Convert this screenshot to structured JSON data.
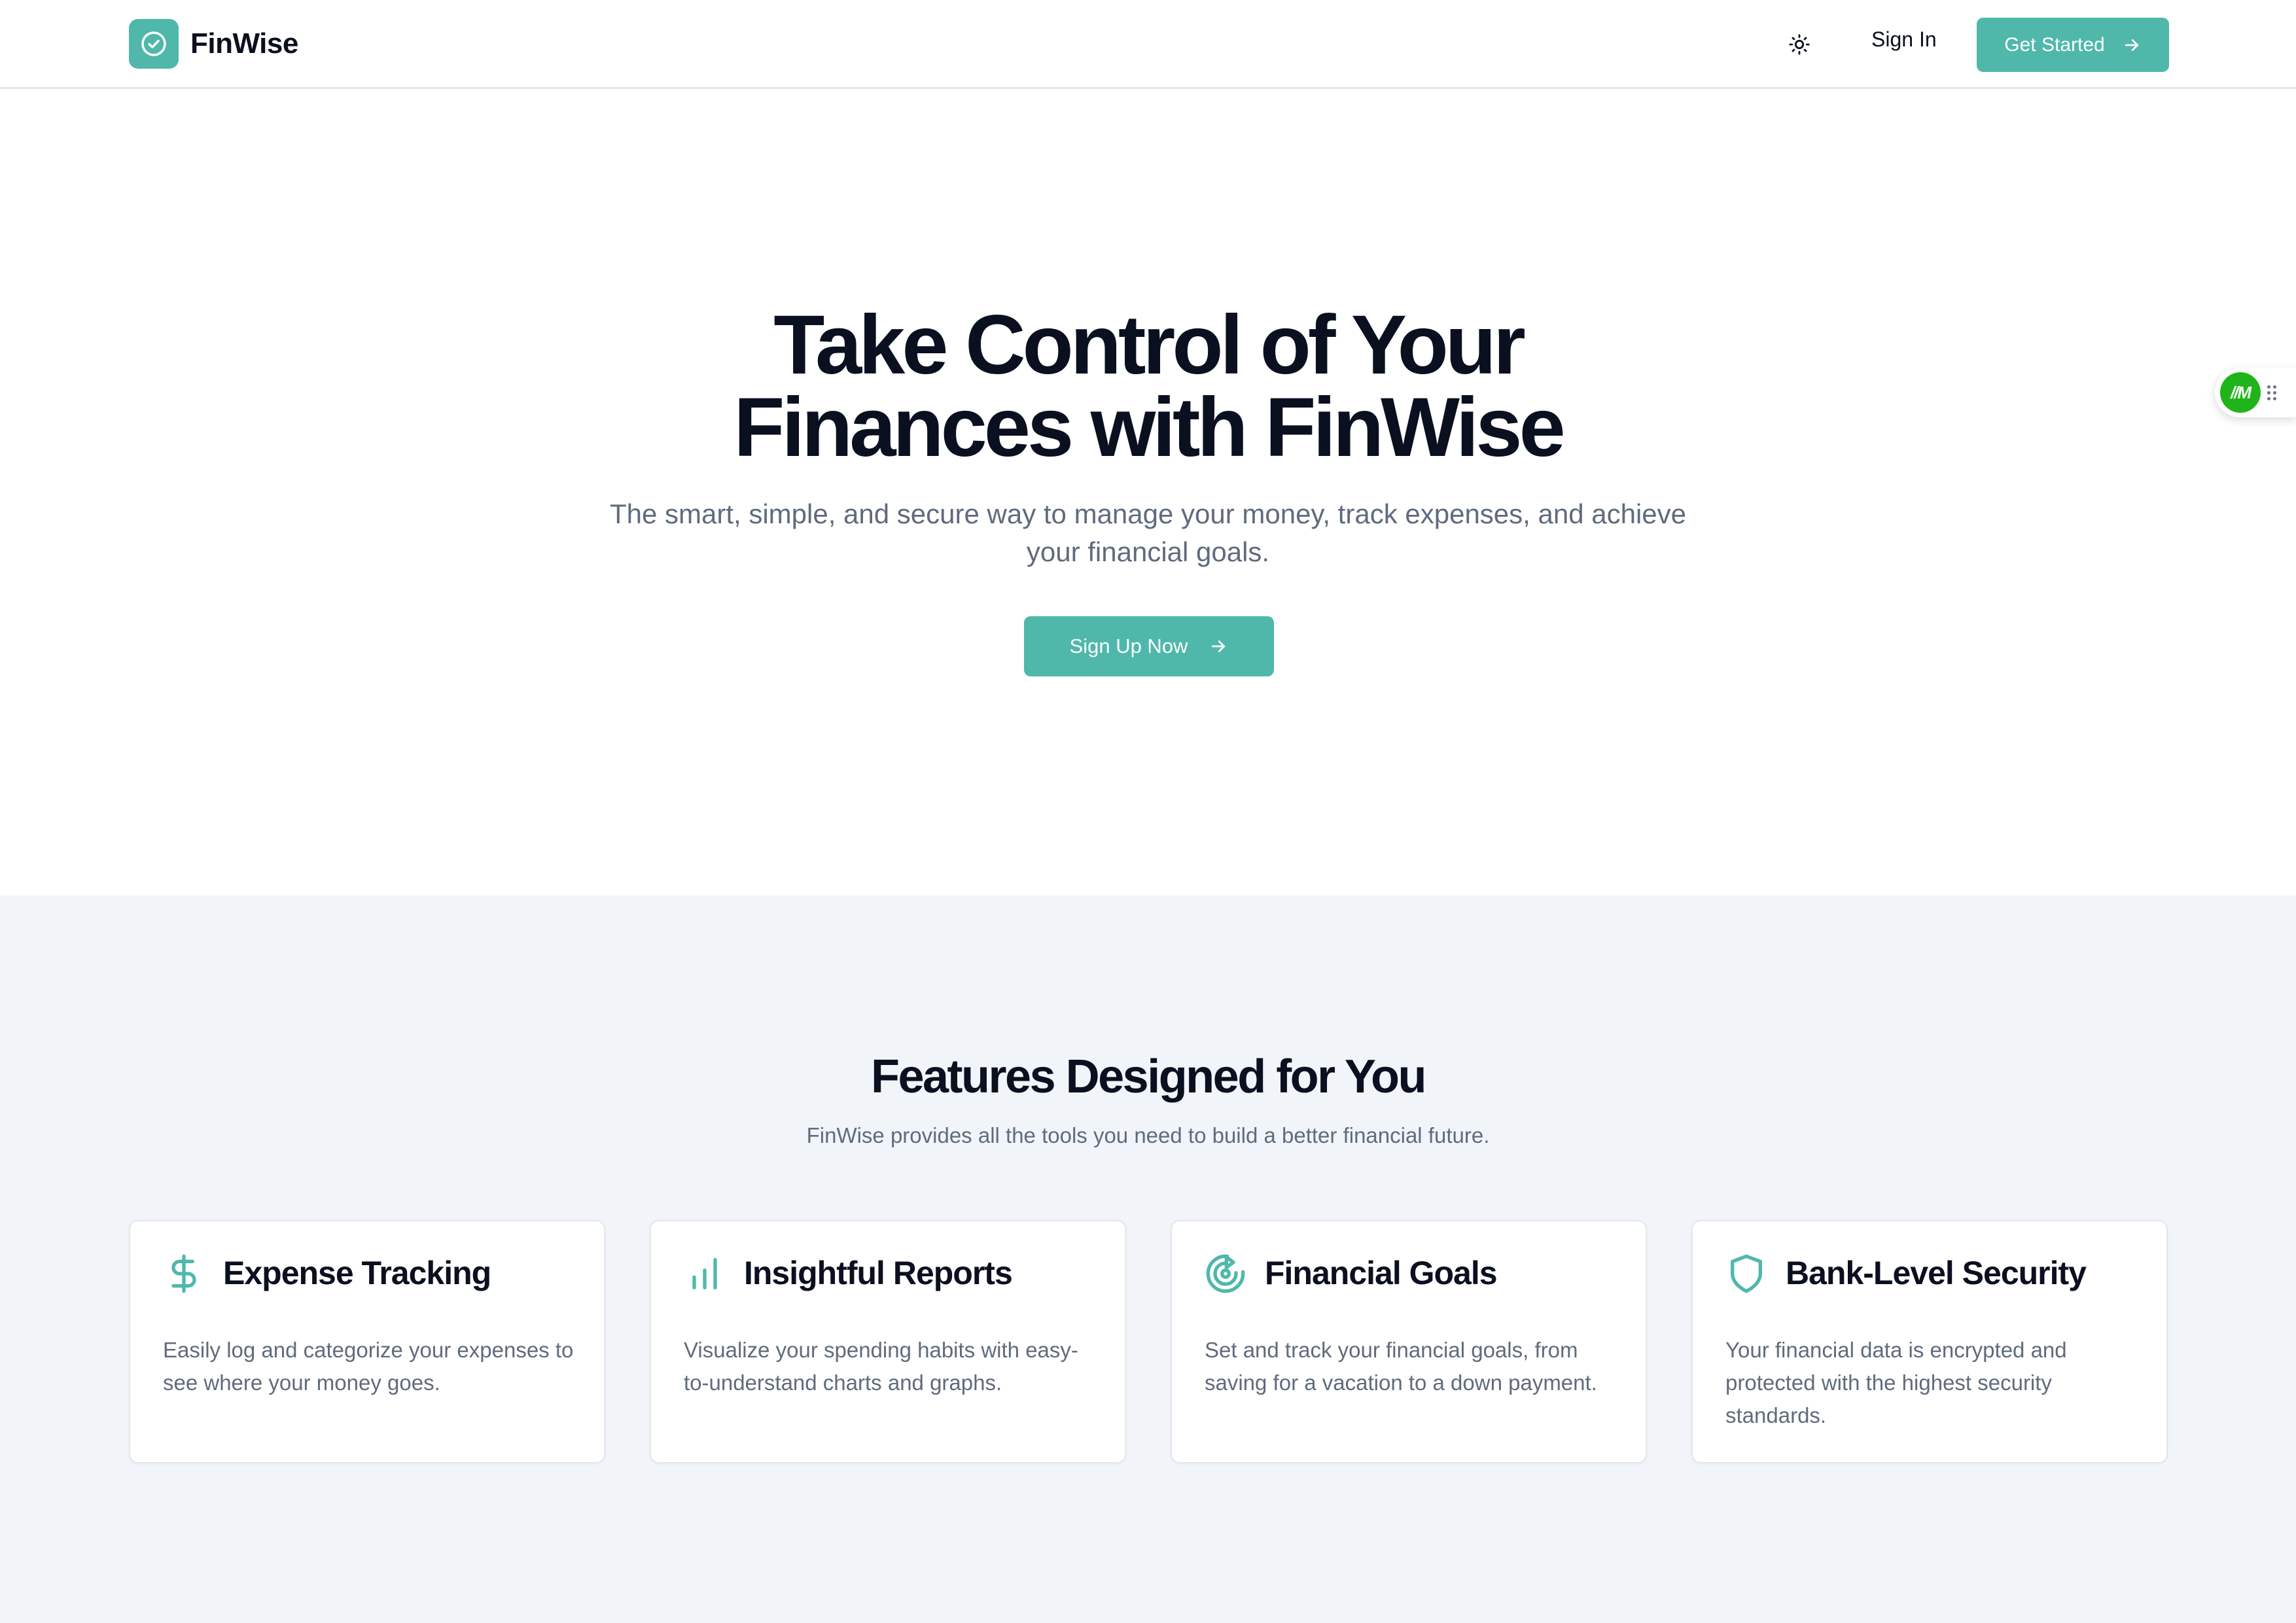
{
  "header": {
    "brand_name": "FinWise",
    "sign_in_label": "Sign In",
    "get_started_label": "Get Started"
  },
  "hero": {
    "title_line1": "Take Control of Your",
    "title_line2": "Finances with FinWise",
    "subtitle": "The smart, simple, and secure way to manage your money, track expenses, and achieve your financial goals.",
    "cta_label": "Sign Up Now"
  },
  "floating_widget": {
    "badge_text": "//M"
  },
  "features": {
    "title": "Features Designed for You",
    "subtitle": "FinWise provides all the tools you need to build a better financial future.",
    "cards": [
      {
        "icon": "dollar-sign-icon",
        "title": "Expense Tracking",
        "description": "Easily log and categorize your expenses to see where your money goes."
      },
      {
        "icon": "bar-chart-icon",
        "title": "Insightful Reports",
        "description": "Visualize your spending habits with easy-to-understand charts and graphs."
      },
      {
        "icon": "target-icon",
        "title": "Financial Goals",
        "description": "Set and track your financial goals, from saving for a vacation to a down payment."
      },
      {
        "icon": "shield-icon",
        "title": "Bank-Level Security",
        "description": "Your financial data is encrypted and protected with the highest security standards."
      }
    ]
  },
  "colors": {
    "accent": "#4fb8ab",
    "heading": "#0b1020",
    "muted_text": "#5f6b7d",
    "features_background": "#f1f4f9",
    "widget_badge": "#1fb51a"
  }
}
